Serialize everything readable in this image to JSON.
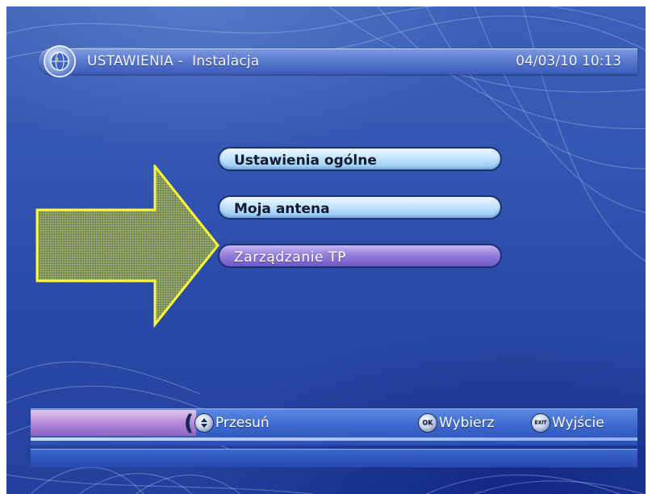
{
  "header": {
    "title": "USTAWIENIA -  Instalacja",
    "datetime": "04/03/10  10:13",
    "logo_icon": "globe-icon"
  },
  "menu": {
    "items": [
      {
        "label": "Ustawienia ogólne",
        "selected": false
      },
      {
        "label": "Moja antena",
        "selected": false
      },
      {
        "label": "Zarządzanie TP",
        "selected": true
      }
    ]
  },
  "footer": {
    "move_icon": "updown-arrows-icon",
    "move_label": "Przesuń",
    "ok_icon": "ok-button-icon",
    "ok_icon_text": "OK",
    "ok_label": "Wybierz",
    "exit_icon": "exit-button-icon",
    "exit_icon_text": "EXIT",
    "exit_label": "Wyjście"
  },
  "annotation": {
    "icon": "yellow-arrow-icon",
    "color": "#ffff33"
  },
  "colors": {
    "background": "#3457b3",
    "menu_normal": "#c4e4fb",
    "menu_selected": "#9380dd",
    "footer_accent": "#b58ad8"
  }
}
